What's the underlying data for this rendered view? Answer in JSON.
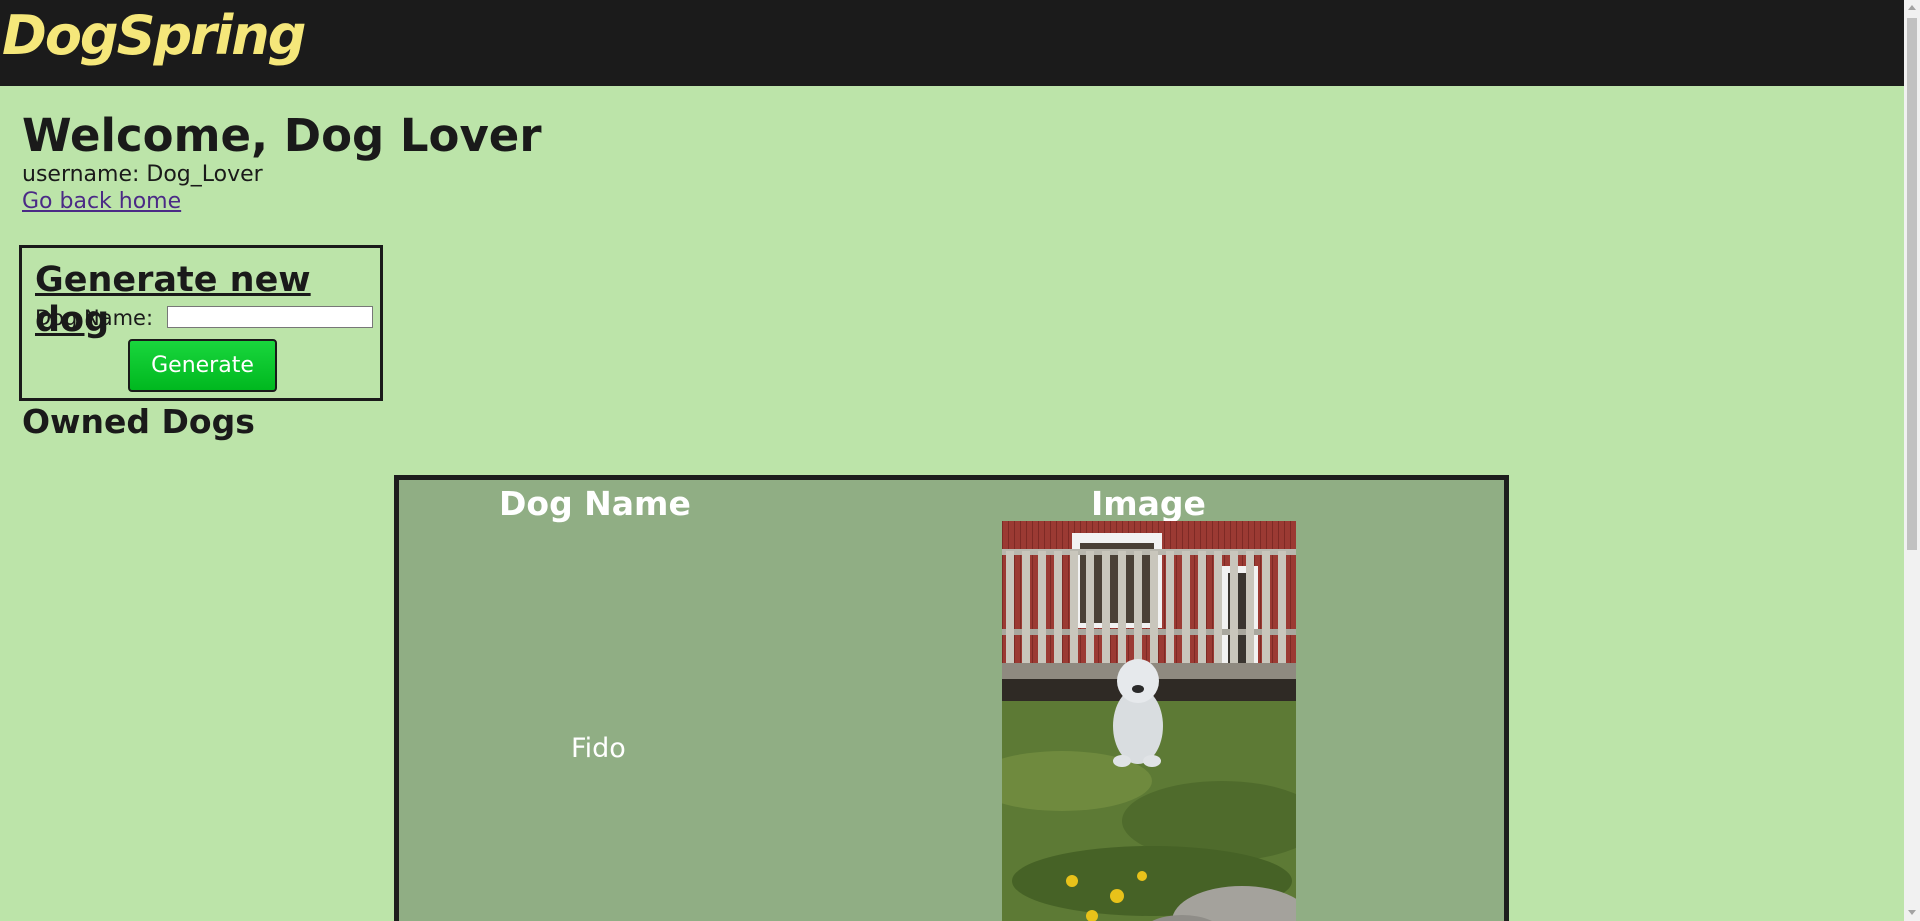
{
  "header": {
    "brand": "DogSpring"
  },
  "profile": {
    "welcome": "Welcome, Dog Lover",
    "username": "username: Dog_Lover",
    "home_link": "Go back home"
  },
  "generator": {
    "title": "Generate new dog",
    "dog_name_label": "Dog Name:",
    "dog_name_value": "",
    "button_label": "Generate"
  },
  "owned": {
    "title": "Owned Dogs",
    "columns": [
      "Dog Name",
      "Image"
    ],
    "rows": [
      {
        "name": "Fido"
      }
    ]
  },
  "colors": {
    "background": "#bce4a9",
    "header": "#1b1b1b",
    "brand": "#f5e77a",
    "table": "#90ae84",
    "button": "#00c82a"
  }
}
